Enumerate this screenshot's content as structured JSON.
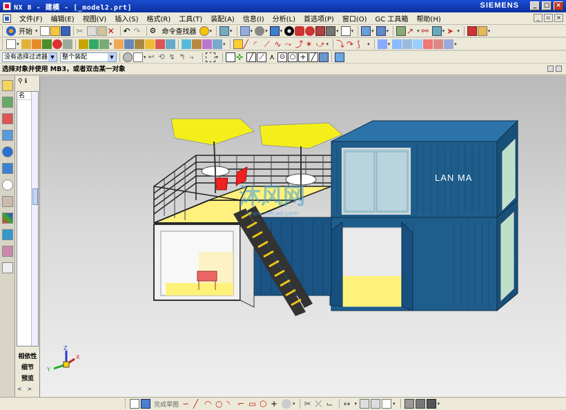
{
  "window": {
    "title": "NX 8 - 建模 - [_model2.prt]",
    "brand": "SIEMENS",
    "controls": [
      "_",
      "□",
      "×"
    ]
  },
  "menubar": {
    "items": [
      "文件(F)",
      "编辑(E)",
      "视图(V)",
      "插入(S)",
      "格式(R)",
      "工具(T)",
      "装配(A)",
      "信息(I)",
      "分析(L)",
      "首选项(P)",
      "窗口(O)",
      "GC 工具箱",
      "帮助(H)"
    ]
  },
  "toolbar1": {
    "start_label": "开始",
    "command_finder_label": "命令查找器"
  },
  "selection_bar": {
    "filter_value": "没有选择过滤器",
    "scope_value": "整个装配"
  },
  "prompt": {
    "text": "选择对象并使用 MB3，或者双击某一对象"
  },
  "navigator": {
    "column_header": "名",
    "buttons": [
      "相依性",
      "细节",
      "预览"
    ]
  },
  "viewport": {
    "container_text": "LAN MA",
    "watermark": "沐风网",
    "watermark_url": "www.mfcad.com",
    "triad": {
      "z": "Z",
      "y": "Y",
      "x": "X"
    }
  },
  "bottom_toolbar": {
    "sketch_label": "完成草图"
  },
  "colors": {
    "titlebar": "#1d4ed2",
    "container_blue": "#1f5d8c",
    "umbrella_yellow": "#f4ef1a",
    "floor_yellow": "#fff27a"
  }
}
